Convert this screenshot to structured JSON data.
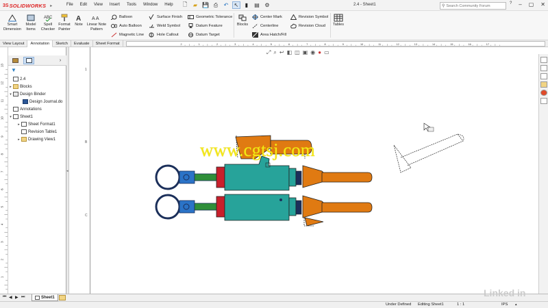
{
  "app": {
    "logo_prefix": "3S",
    "logo_name": "SOLIDWORKS",
    "doc_title": "2.4 - Sheet1"
  },
  "menu": [
    "File",
    "Edit",
    "View",
    "Insert",
    "Tools",
    "Window",
    "Help"
  ],
  "search": {
    "placeholder": "Search Community Forum"
  },
  "ribbon": {
    "smart_dimension": "Smart Dimension",
    "model_items": "Model Items",
    "spell_checker": "Spell Checker",
    "format_painter": "Format Painter",
    "note": "Note",
    "linear_note_pattern": "Linear Note Pattern",
    "balloon": "Balloon",
    "auto_balloon": "Auto Balloon",
    "magnetic_line": "Magnetic Line",
    "surface_finish": "Surface Finish",
    "weld_symbol": "Weld Symbol",
    "hole_callout": "Hole Callout",
    "geometric_tolerance": "Geometric Tolerance",
    "datum_feature": "Datum Feature",
    "datum_target": "Datum Target",
    "blocks": "Blocks",
    "center_mark": "Center Mark",
    "centerline": "Centerline",
    "area_hatch": "Area Hatch/Fill",
    "revision_symbol": "Revision Symbol",
    "revision_cloud": "Revision Cloud",
    "tables": "Tables"
  },
  "tabs": [
    "View Layout",
    "Annotation",
    "Sketch",
    "Evaluate",
    "Sheet Format"
  ],
  "active_tab": "Annotation",
  "hruler_ticks": [
    "2",
    "1",
    "2",
    "3",
    "4",
    "5",
    "6",
    "7",
    "8",
    "9",
    "10",
    "11",
    "12",
    "13",
    "14",
    "15",
    "16",
    "17"
  ],
  "vruler_ticks": [
    "13",
    "12",
    "11",
    "10",
    "9",
    "8",
    "7",
    "6",
    "5",
    "4",
    "3",
    "2",
    "1"
  ],
  "sheet_zone_labels": [
    "1",
    "B",
    "C"
  ],
  "tree": {
    "root": "2.4",
    "items": [
      {
        "label": "Blocks"
      },
      {
        "label": "Design Binder"
      },
      {
        "label": "Design Journal.do"
      },
      {
        "label": "Annotations"
      },
      {
        "label": "Sheet1"
      },
      {
        "label": "Sheet Format1"
      },
      {
        "label": "Revision Table1"
      },
      {
        "label": "Drawing View1"
      }
    ]
  },
  "sheet_tab": "Sheet1",
  "status": {
    "defined": "Under Defined",
    "editing": "Editing Sheet1",
    "scale": "1 : 1",
    "units": "IPS"
  },
  "watermark": "www.cgtsj.com",
  "brand_watermark": "Linked in",
  "colors": {
    "teal": "#27a39a",
    "orange": "#e07a12",
    "red": "#c8202c",
    "navy": "#1b2f5a",
    "green": "#2f8f3a",
    "blue": "#2b73c7"
  }
}
